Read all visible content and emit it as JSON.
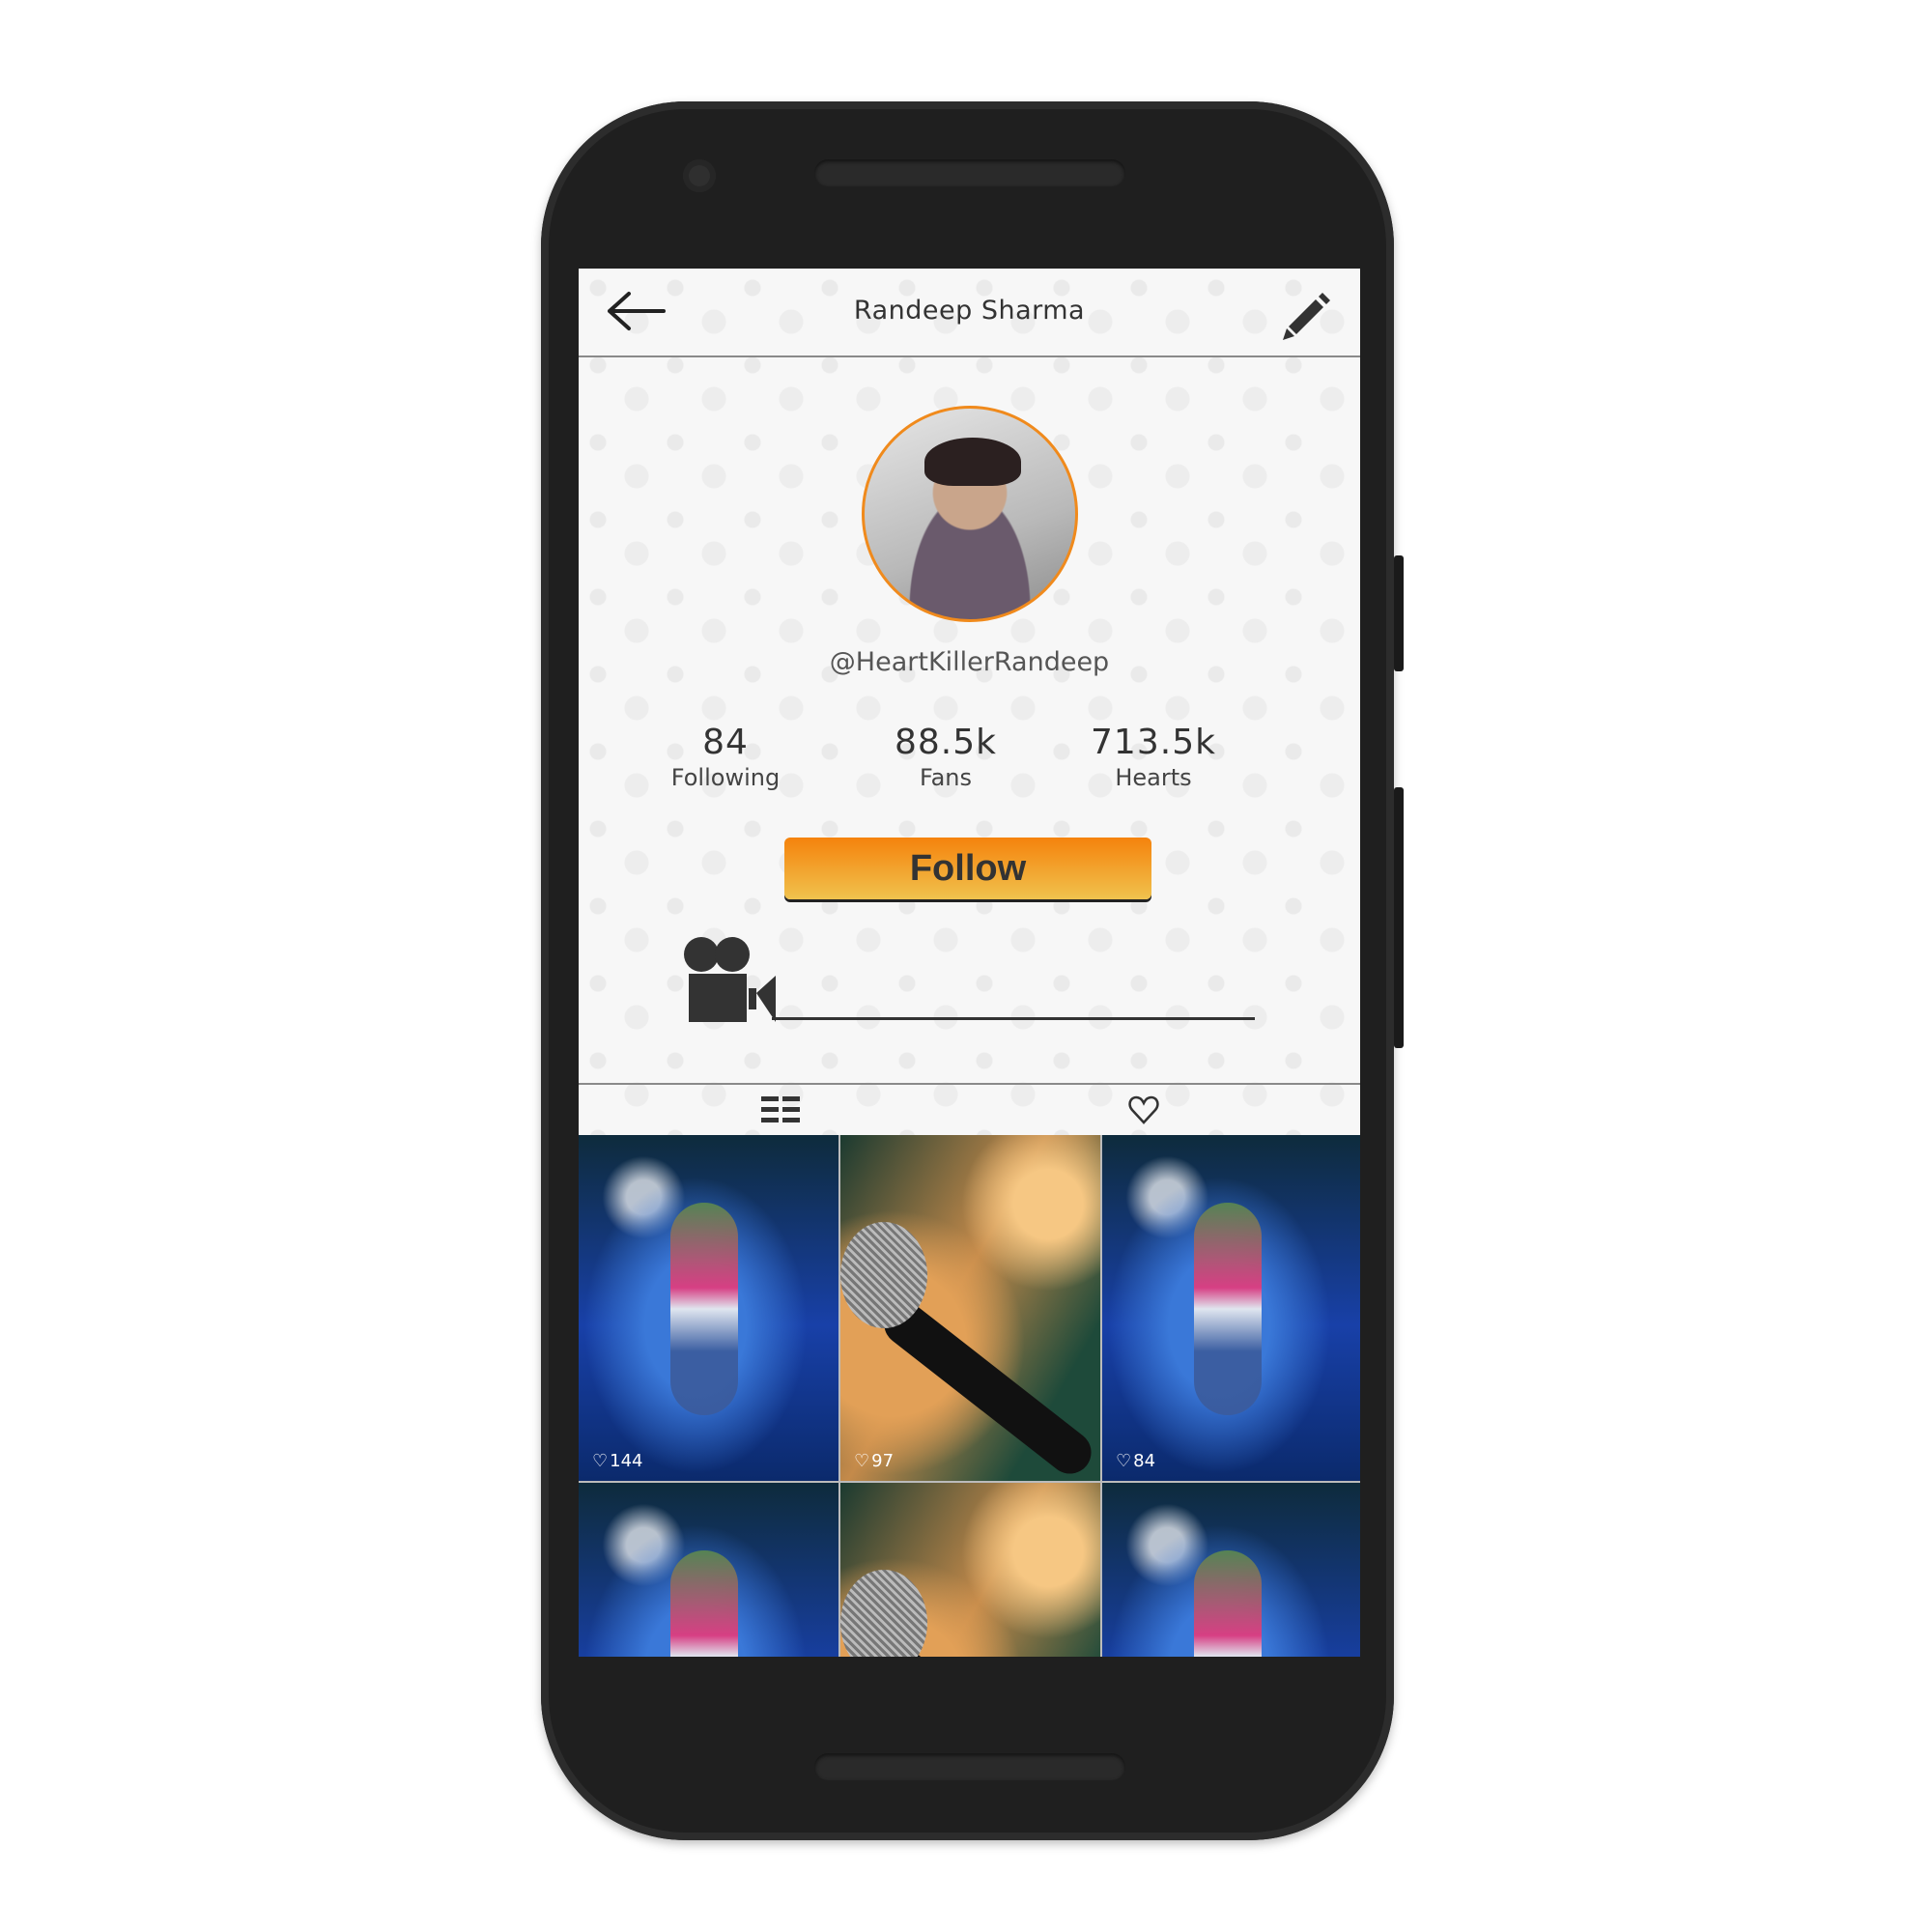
{
  "header": {
    "back_icon": "arrow-left-icon",
    "title": "Randeep Sharma",
    "edit_icon": "pencil-icon"
  },
  "profile": {
    "avatar": "profile-photo",
    "handle": "@HeartKillerRandeep",
    "accent_color": "#f08a1c"
  },
  "stats": [
    {
      "value": "84",
      "label": "Following"
    },
    {
      "value": "88.5k",
      "label": "Fans"
    },
    {
      "value": "713.5k",
      "label": "Hearts"
    }
  ],
  "follow_button": {
    "label": "Follow",
    "gradient": [
      "#f5820c",
      "#f0c24e"
    ]
  },
  "videos_section_icon": "movie-camera-icon",
  "tabs": [
    {
      "icon": "grid-list-icon",
      "name": "videos"
    },
    {
      "icon": "heart-outline-icon",
      "name": "liked"
    }
  ],
  "videos": [
    {
      "type": "dance",
      "likes": "144"
    },
    {
      "type": "microphone",
      "likes": "97"
    },
    {
      "type": "dance",
      "likes": "84"
    },
    {
      "type": "dance",
      "likes": ""
    },
    {
      "type": "microphone",
      "likes": ""
    },
    {
      "type": "dance",
      "likes": ""
    }
  ]
}
